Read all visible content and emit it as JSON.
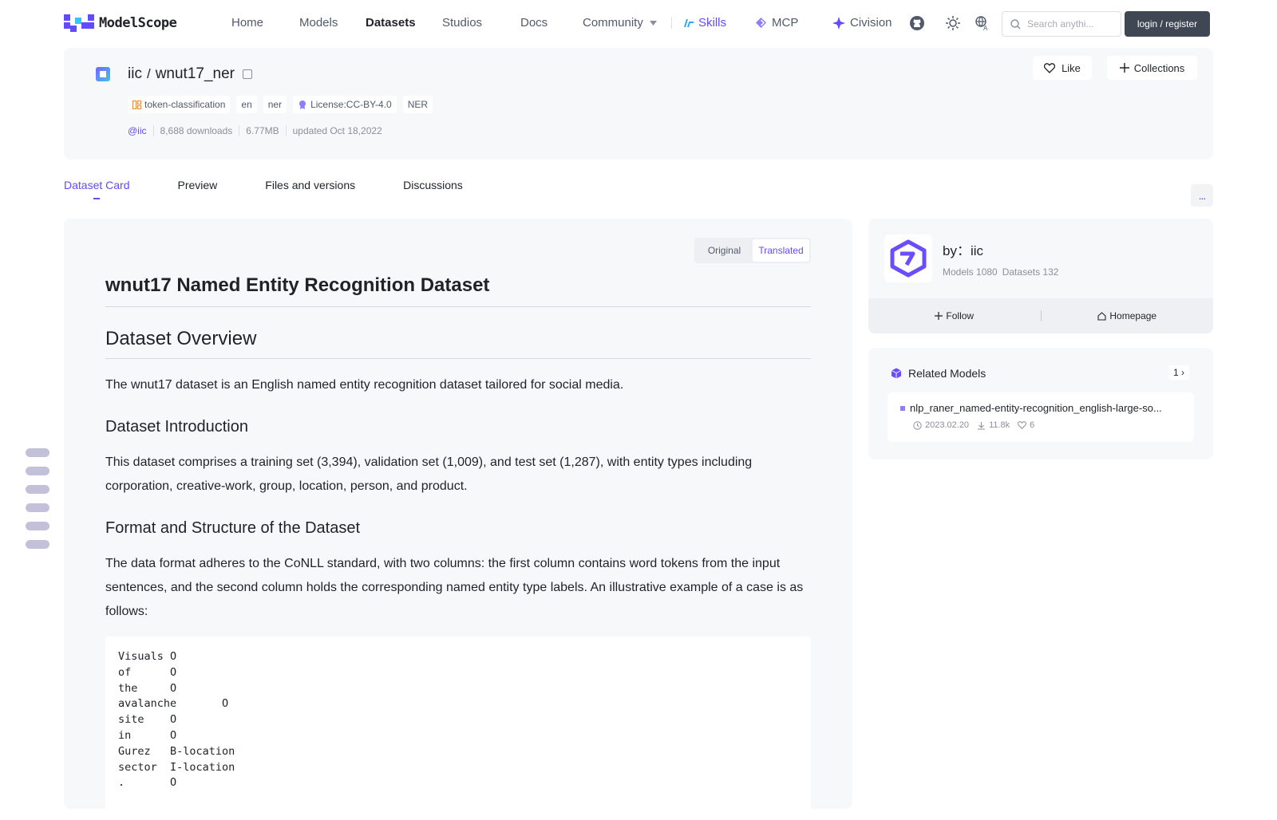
{
  "brand": {
    "name": "ModelScope",
    "accent": "#624aff"
  },
  "nav": {
    "home": "Home",
    "models": "Models",
    "datasets": "Datasets",
    "studios": "Studios",
    "docs": "Docs",
    "community": "Community",
    "skills": "Skills",
    "mcp": "MCP",
    "civision": "Civision",
    "search_placeholder": "Search anythi...",
    "login": "login / register"
  },
  "dataset": {
    "owner": "iic",
    "slash": "/",
    "name": "wnut17_ner",
    "tags": [
      "token-classification",
      "en",
      "ner",
      "License:CC-BY-4.0",
      "NER"
    ],
    "author_handle": "@iic",
    "downloads": "8,688 downloads",
    "size": "6.77MB",
    "updated": "updated Oct 18,2022",
    "like_label": "Like",
    "collections_label": "Collections"
  },
  "tabs": [
    "Dataset Card",
    "Preview",
    "Files and versions",
    "Discussions"
  ],
  "more_label": "...",
  "toggle": {
    "original": "Original",
    "translated": "Translated"
  },
  "card": {
    "title": "wnut17 Named Entity Recognition Dataset",
    "overview_heading": "Dataset Overview",
    "overview_text": "The wnut17 dataset is an English named entity recognition dataset tailored for social media.",
    "intro_heading": "Dataset Introduction",
    "intro_text": "This dataset comprises a training set (3,394), validation set (1,009), and test set (1,287), with entity types including corporation, creative-work, group, location, person, and product.",
    "format_heading": "Format and Structure of the Dataset",
    "format_text": "The data format adheres to the CoNLL standard, with two columns: the first column contains word tokens from the input sentences, and the second column holds the corresponding named entity type labels. An illustrative example of a case is as follows:",
    "code": "Visuals O\nof      O\nthe     O\navalanche       O\nsite    O\nin      O\nGurez   B-location\nsector  I-location\n.       O"
  },
  "author": {
    "name": "by：iic",
    "models": "Models 1080",
    "datasets": "Datasets 132",
    "follow": "Follow",
    "homepage": "Homepage"
  },
  "related": {
    "heading": "Related Models",
    "count": "1",
    "item_name": "nlp_raner_named-entity-recognition_english-large-so...",
    "item_date": "2023.02.20",
    "item_downloads": "11.8k",
    "item_likes": "6"
  }
}
